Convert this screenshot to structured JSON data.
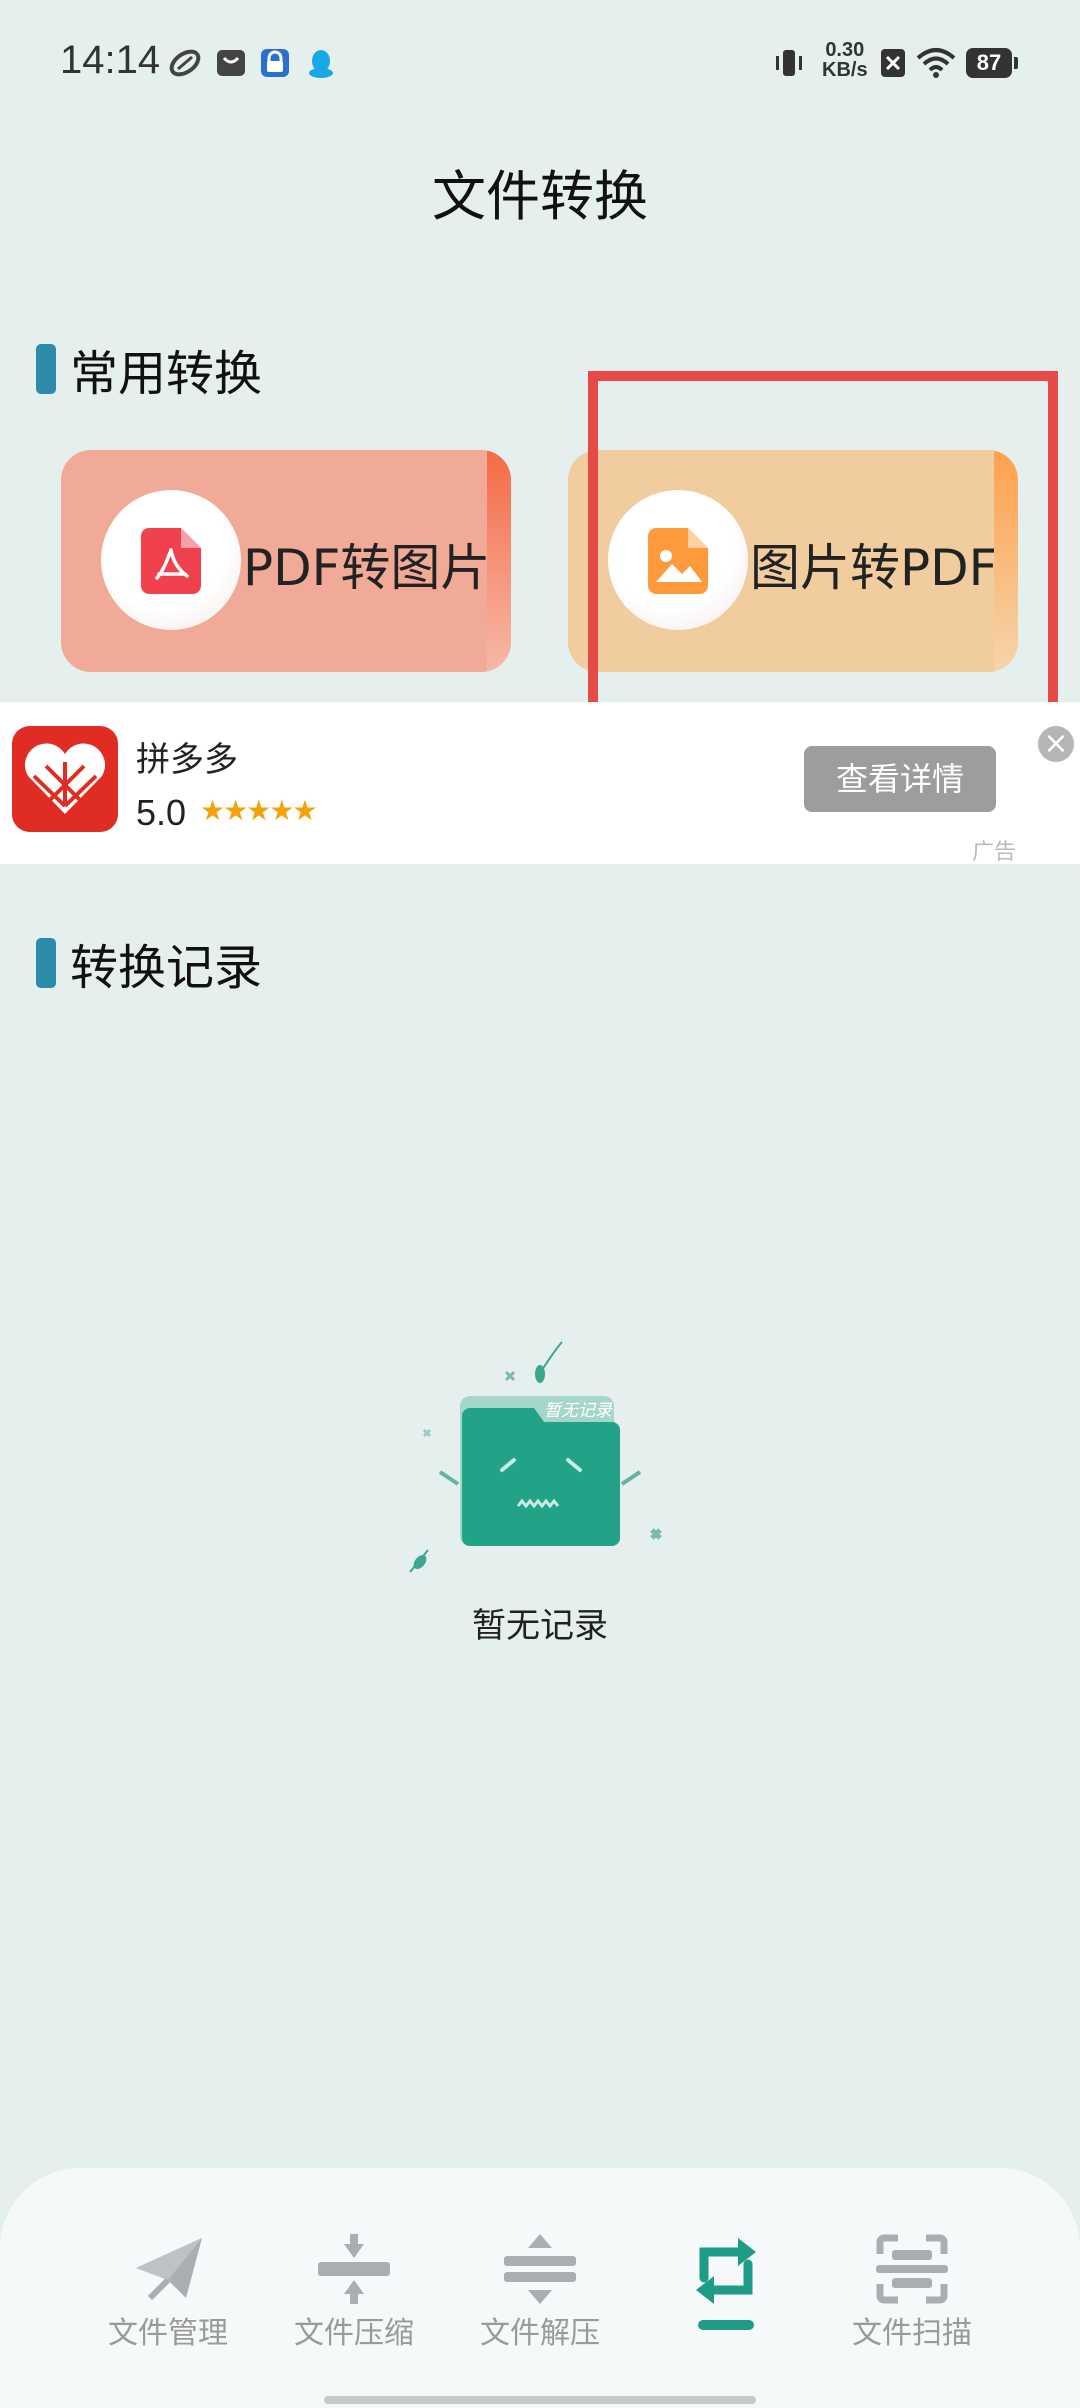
{
  "status_bar": {
    "time": "14:14",
    "net_speed_value": "0.30",
    "net_speed_unit": "KB/s",
    "battery": "87"
  },
  "page_title": "文件转换",
  "common": {
    "section_title": "常用转换",
    "cards": [
      {
        "label": "PDF转图片",
        "icon": "pdf-file-icon"
      },
      {
        "label": "图片转PDF",
        "icon": "image-file-icon"
      }
    ]
  },
  "ad": {
    "app_name": "拼多多",
    "rating": "5.0",
    "stars": "★★★★★",
    "button": "查看详情",
    "close": "×",
    "tag": "广告"
  },
  "records": {
    "section_title": "转换记录",
    "empty_badge": "暂无记录",
    "empty_text": "暂无记录"
  },
  "tabs": [
    {
      "label": "文件管理",
      "icon": "paper-plane-icon",
      "active": false
    },
    {
      "label": "文件压缩",
      "icon": "compress-icon",
      "active": false
    },
    {
      "label": "文件解压",
      "icon": "decompress-icon",
      "active": false
    },
    {
      "label": "",
      "icon": "convert-icon",
      "active": true
    },
    {
      "label": "文件扫描",
      "icon": "scan-icon",
      "active": false
    }
  ],
  "colors": {
    "accent": "#1e9c85",
    "section_bar": "#2c8ba8",
    "highlight": "#e64a47"
  }
}
